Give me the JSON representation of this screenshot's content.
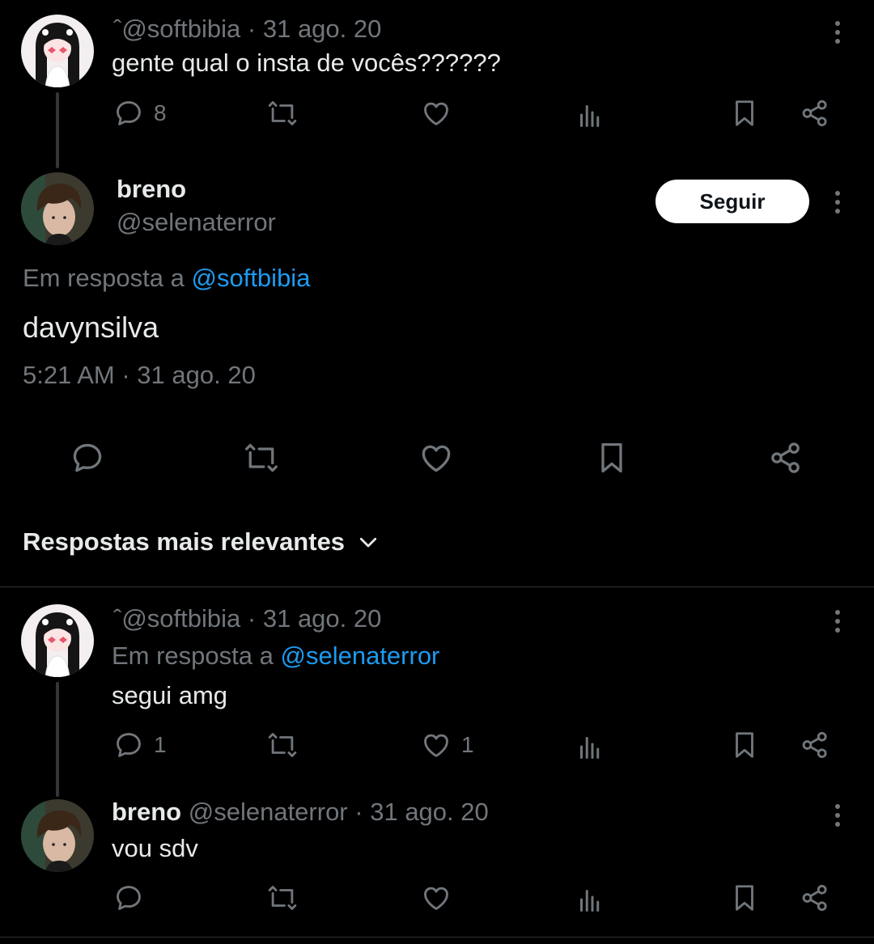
{
  "tweet1": {
    "author_prefix": "ˆ",
    "handle": "@softbibia",
    "date": "31 ago. 20",
    "text": "gente qual o insta de vocês??????",
    "replies": "8"
  },
  "main_tweet": {
    "name": "breno",
    "handle": "@selenaterror",
    "follow_label": "Seguir",
    "reply_prefix": "Em resposta a",
    "reply_to": "@softbibia",
    "text": "davynsilva",
    "timestamp": "5:21 AM · 31 ago. 20"
  },
  "sort": {
    "label": "Respostas mais relevantes"
  },
  "reply1": {
    "author_prefix": "ˆ",
    "handle": "@softbibia",
    "date": "31 ago. 20",
    "reply_prefix": "Em resposta a",
    "reply_to": "@selenaterror",
    "text": "segui amg",
    "replies": "1",
    "likes": "1"
  },
  "reply2": {
    "name": "breno",
    "handle": "@selenaterror",
    "date": "31 ago. 20",
    "text": "vou sdv"
  },
  "separator": "·",
  "colors": {
    "background": "#000000",
    "text": "#e7e9ea",
    "muted": "#71767b",
    "link": "#1d9bf0"
  },
  "icons": [
    "reply-icon",
    "retweet-icon",
    "like-icon",
    "views-icon",
    "bookmark-icon",
    "share-icon",
    "more-icon",
    "chevron-down-icon"
  ]
}
